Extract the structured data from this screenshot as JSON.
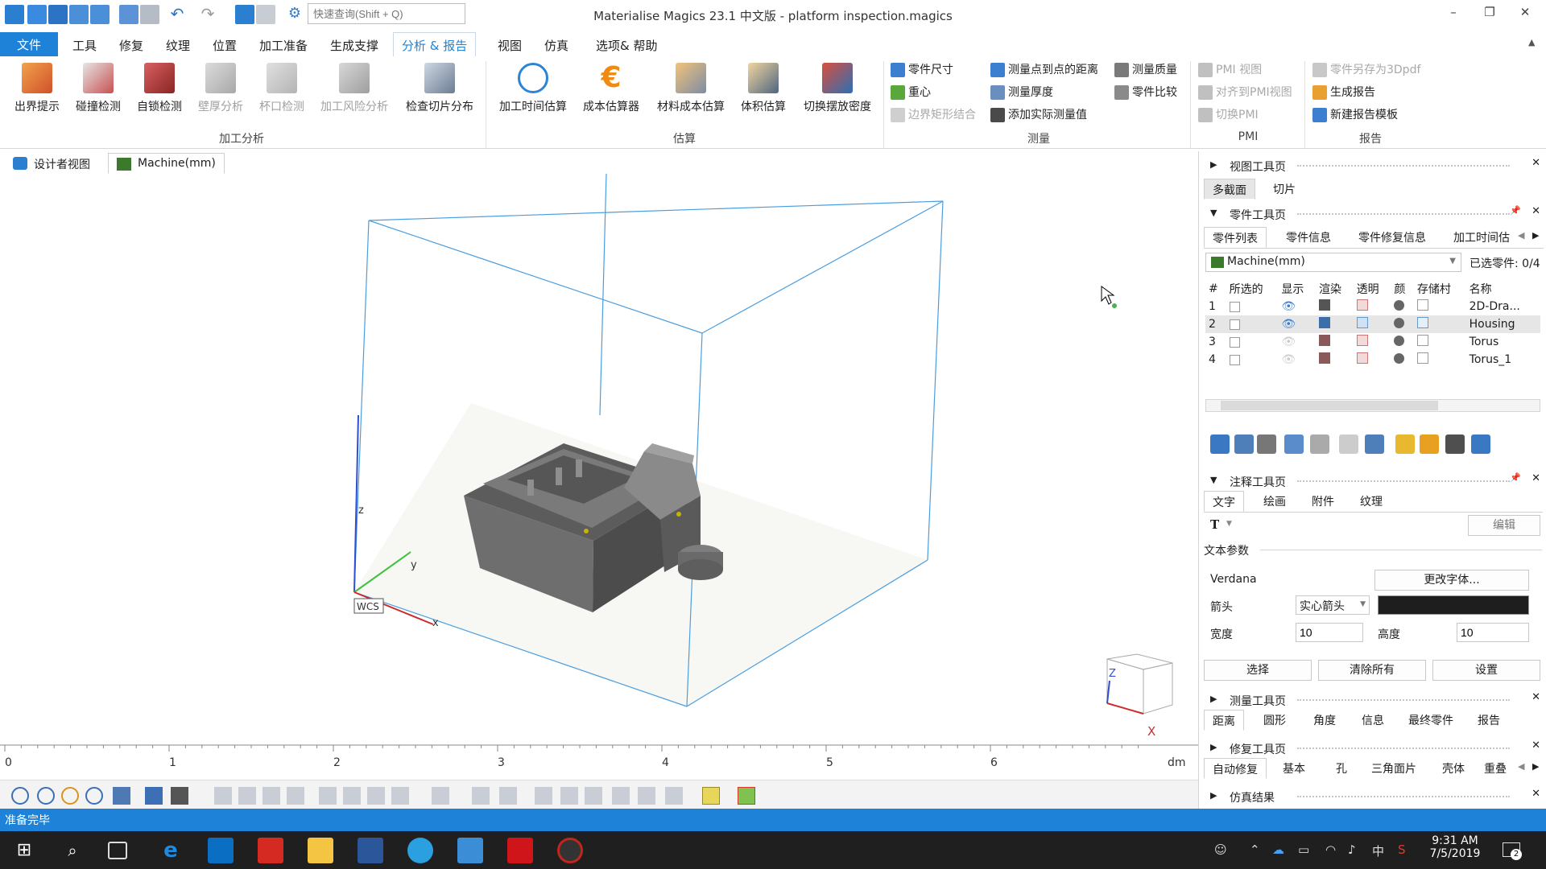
{
  "window": {
    "title": "Materialise Magics 23.1 中文版 - platform inspection.magics",
    "search_placeholder": "快速查询(Shift + Q)"
  },
  "menu": [
    "文件",
    "工具",
    "修复",
    "纹理",
    "位置",
    "加工准备",
    "生成支撑",
    "分析 & 报告",
    "视图",
    "仿真",
    "选项& 帮助"
  ],
  "ribbon": {
    "analysis_buttons": [
      "出界提示",
      "碰撞检测",
      "自锁检测",
      "壁厚分析",
      "杯口检测",
      "加工风险分析",
      "检查切片分布"
    ],
    "analysis_group": "加工分析",
    "estimate_buttons": [
      "加工时间估算",
      "成本估算器",
      "材料成本估算",
      "体积估算",
      "切换摆放密度"
    ],
    "estimate_group": "估算",
    "measure_col1": [
      "零件尺寸",
      "重心",
      "边界矩形结合"
    ],
    "measure_col2": [
      "测量点到点的距离",
      "测量厚度",
      "添加实际测量值"
    ],
    "measure_col3": [
      "测量质量",
      "零件比较"
    ],
    "measure_group": "测量",
    "pmi_items": [
      "PMI 视图",
      "对齐到PMI视图",
      "切换PMI"
    ],
    "pmi_group": "PMI",
    "report_items": [
      "零件另存为3Dpdf",
      "生成报告",
      "新建报告模板"
    ],
    "report_group": "报告"
  },
  "doc_tabs": [
    "设计者视图",
    "Machine(mm)"
  ],
  "viewport": {
    "ruler_labels": [
      "0",
      "1",
      "2",
      "3",
      "4",
      "5",
      "6"
    ],
    "ruler_unit": "dm",
    "axis_z": "z",
    "axis_y": "y",
    "axis_x": "x",
    "wcs": "WCS",
    "cube_z": "Z",
    "cube_x": "X"
  },
  "status_text": "准备完毕",
  "right_panel": {
    "view_tools": {
      "title": "视图工具页",
      "tabs": [
        "多截面",
        "切片"
      ]
    },
    "part_tools": {
      "title": "零件工具页",
      "tabs": [
        "零件列表",
        "零件信息",
        "零件修复信息",
        "加工时间估"
      ],
      "machine": "Machine(mm)",
      "selected": "已选零件: 0/4",
      "columns": [
        "#",
        "所选的",
        "显示",
        "渲染",
        "透明",
        "颜",
        "存储村",
        "名称"
      ],
      "rows": [
        {
          "num": "1",
          "name": "2D-Dra..."
        },
        {
          "num": "2",
          "name": "Housing"
        },
        {
          "num": "3",
          "name": "Torus"
        },
        {
          "num": "4",
          "name": "Torus_1"
        }
      ]
    },
    "annotation_tools": {
      "title": "注释工具页",
      "tabs": [
        "文字",
        "绘画",
        "附件",
        "纹理"
      ],
      "text_symbol": "T",
      "edit_button": "编辑",
      "params_label": "文本参数",
      "font_name": "Verdana",
      "change_font": "更改字体...",
      "arrow_label": "箭头",
      "arrow_value": "实心箭头",
      "width_label": "宽度",
      "width_value": "10",
      "height_label": "高度",
      "height_value": "10",
      "btn_select": "选择",
      "btn_clear": "清除所有",
      "btn_settings": "设置"
    },
    "measure_tools": {
      "title": "测量工具页",
      "tabs": [
        "距离",
        "圆形",
        "角度",
        "信息",
        "最终零件",
        "报告"
      ]
    },
    "repair_tools": {
      "title": "修复工具页",
      "tabs": [
        "自动修复",
        "基本",
        "孔",
        "三角面片",
        "壳体",
        "重叠"
      ]
    },
    "sim_results": {
      "title": "仿真结果"
    }
  },
  "taskbar": {
    "time": "9:31 AM",
    "date": "7/5/2019",
    "ime": "中",
    "notification_count": "2"
  }
}
